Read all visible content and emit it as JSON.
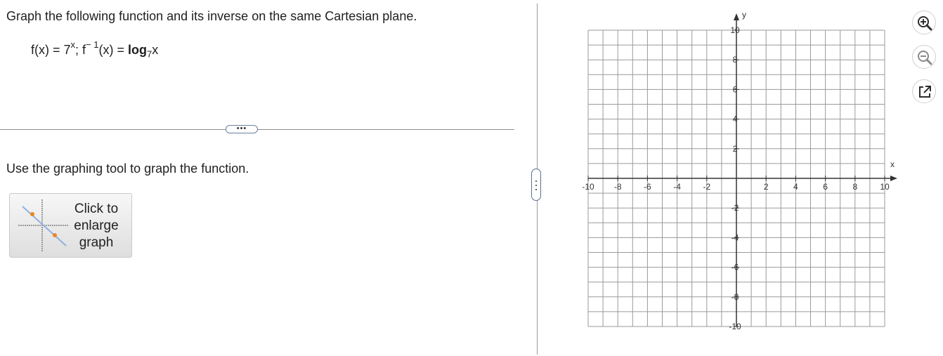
{
  "question": {
    "prompt": "Graph the following function and its inverse on the same Cartesian plane.",
    "f_lhs": "f(x) = 7",
    "f_exp": "x",
    "sep": "; f",
    "inv_exp": "− 1",
    "inv_lhs": "(x) = ",
    "log_word": "log",
    "log_base": "7",
    "log_arg": "x"
  },
  "more_button": {
    "label": "•••"
  },
  "instruction": "Use the graphing tool to graph the function.",
  "enlarge_button": {
    "label_line1": "Click to",
    "label_line2": "enlarge",
    "label_line3": "graph"
  },
  "graph": {
    "x_axis_label": "x",
    "y_axis_label": "y",
    "xlim": [
      -10,
      10
    ],
    "ylim": [
      -10,
      10
    ],
    "grid_step": 1,
    "x_tick_labels": [
      "-10",
      "-8",
      "-6",
      "-4",
      "-2",
      "2",
      "4",
      "6",
      "8",
      "10"
    ],
    "y_tick_labels": [
      "10",
      "8",
      "6",
      "4",
      "2",
      "-2",
      "-4",
      "-6",
      "-8",
      "-10"
    ]
  },
  "tools": {
    "zoom_in": "zoom-in-icon",
    "zoom_out": "zoom-out-icon",
    "popout": "popout-icon"
  },
  "colors": {
    "grid": "#9a9a9a",
    "axis": "#333333",
    "accent": "#2a6ebb"
  }
}
